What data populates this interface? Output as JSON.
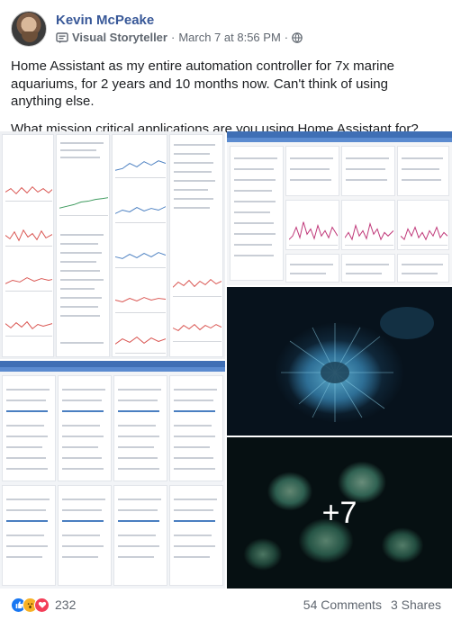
{
  "post": {
    "author": "Kevin McPeake",
    "badge_label": "Visual Storyteller",
    "separator": "·",
    "timestamp": "March 7 at 8:56 PM",
    "text_paragraph_1": "Home Assistant as my entire automation controller for 7x marine aquariums, for 2 years and 10 months now. Can't think of using anything else.",
    "text_paragraph_2": "What mission critical applications are you using Home Assistant for?"
  },
  "photos": {
    "more_count": "+7"
  },
  "footer": {
    "reaction_count": "232",
    "comments_label": "54 Comments",
    "shares_label": "3 Shares"
  },
  "colors": {
    "author_link": "#385898",
    "like_blue": "#1877f2",
    "wow_yellow": "#f7b125",
    "love_red": "#f33e58",
    "dashboard_header": "#3f6fb5"
  },
  "icons": [
    "avatar",
    "visual-storyteller-badge-icon",
    "globe-icon",
    "like-icon",
    "wow-icon",
    "love-icon"
  ]
}
